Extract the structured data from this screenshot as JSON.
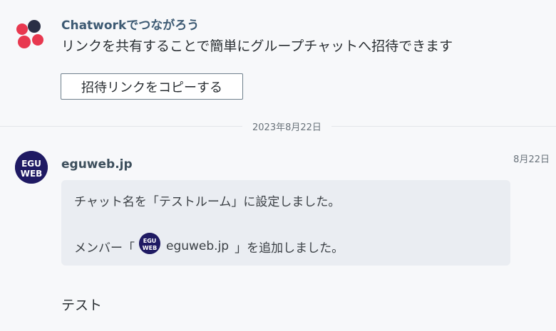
{
  "invite": {
    "title": "Chatworkでつながろう",
    "description": "リンクを共有することで簡単にグループチャットへ招待できます",
    "copy_button": "招待リンクをコピーする"
  },
  "date_separator": "2023年8月22日",
  "message": {
    "sender": "eguweb.jp",
    "avatar_text": [
      "EGU",
      "WEB"
    ],
    "timestamp": "8月22日",
    "system_line1": "チャット名を「テストルーム」に設定しました。",
    "system_line2_prefix": "メンバー「",
    "system_line2_member": "eguweb.jp",
    "system_line2_suffix": "」を追加しました。",
    "text": "テスト"
  },
  "colors": {
    "accent": "#3d5a73",
    "logo_red": "#e8384f",
    "logo_navy": "#2a2f45",
    "avatar_bg": "#1f1a63",
    "system_bg": "#eaedf2"
  }
}
